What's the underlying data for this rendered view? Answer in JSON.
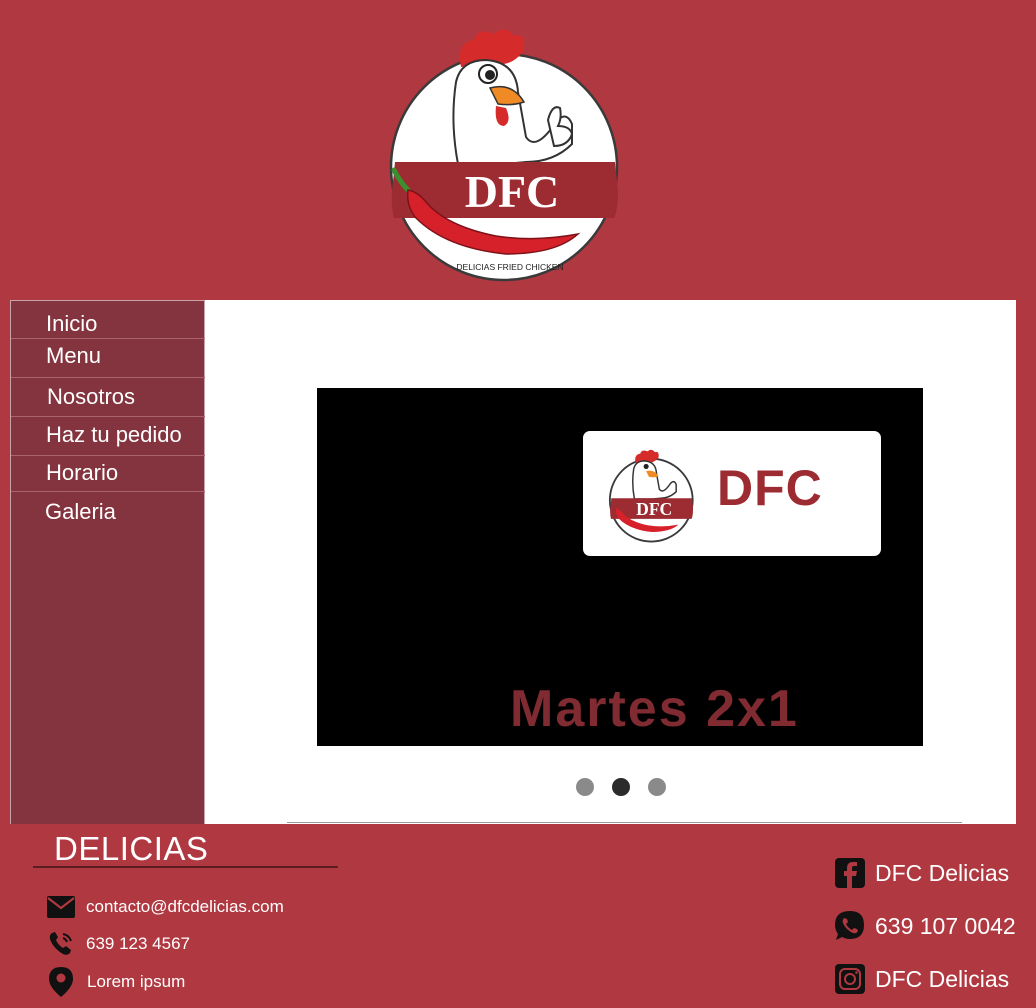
{
  "logo": {
    "brand": "DFC",
    "tagline": "DELICIAS FRIED CHICKEN"
  },
  "nav": {
    "items": [
      {
        "label": "Inicio"
      },
      {
        "label": "Menu"
      },
      {
        "label": "Nosotros"
      },
      {
        "label": "Haz tu pedido"
      },
      {
        "label": "Horario"
      },
      {
        "label": "Galeria"
      }
    ]
  },
  "carousel": {
    "slide": {
      "brand": "DFC",
      "promo": "Martes 2x1"
    },
    "slide_count": 3,
    "active_index": 1
  },
  "footer": {
    "title": "DELICIAS",
    "email": "contacto@dfcdelicias.com",
    "phone": "639 123 4567",
    "address": "Lorem ipsum",
    "facebook": "DFC Delicias",
    "whatsapp": "639 107 0042",
    "instagram": "DFC Delicias"
  },
  "colors": {
    "background": "#b03840",
    "sidebar": "#84343f",
    "brand_red": "#9c2b32",
    "promo_text": "#7f2b31"
  }
}
